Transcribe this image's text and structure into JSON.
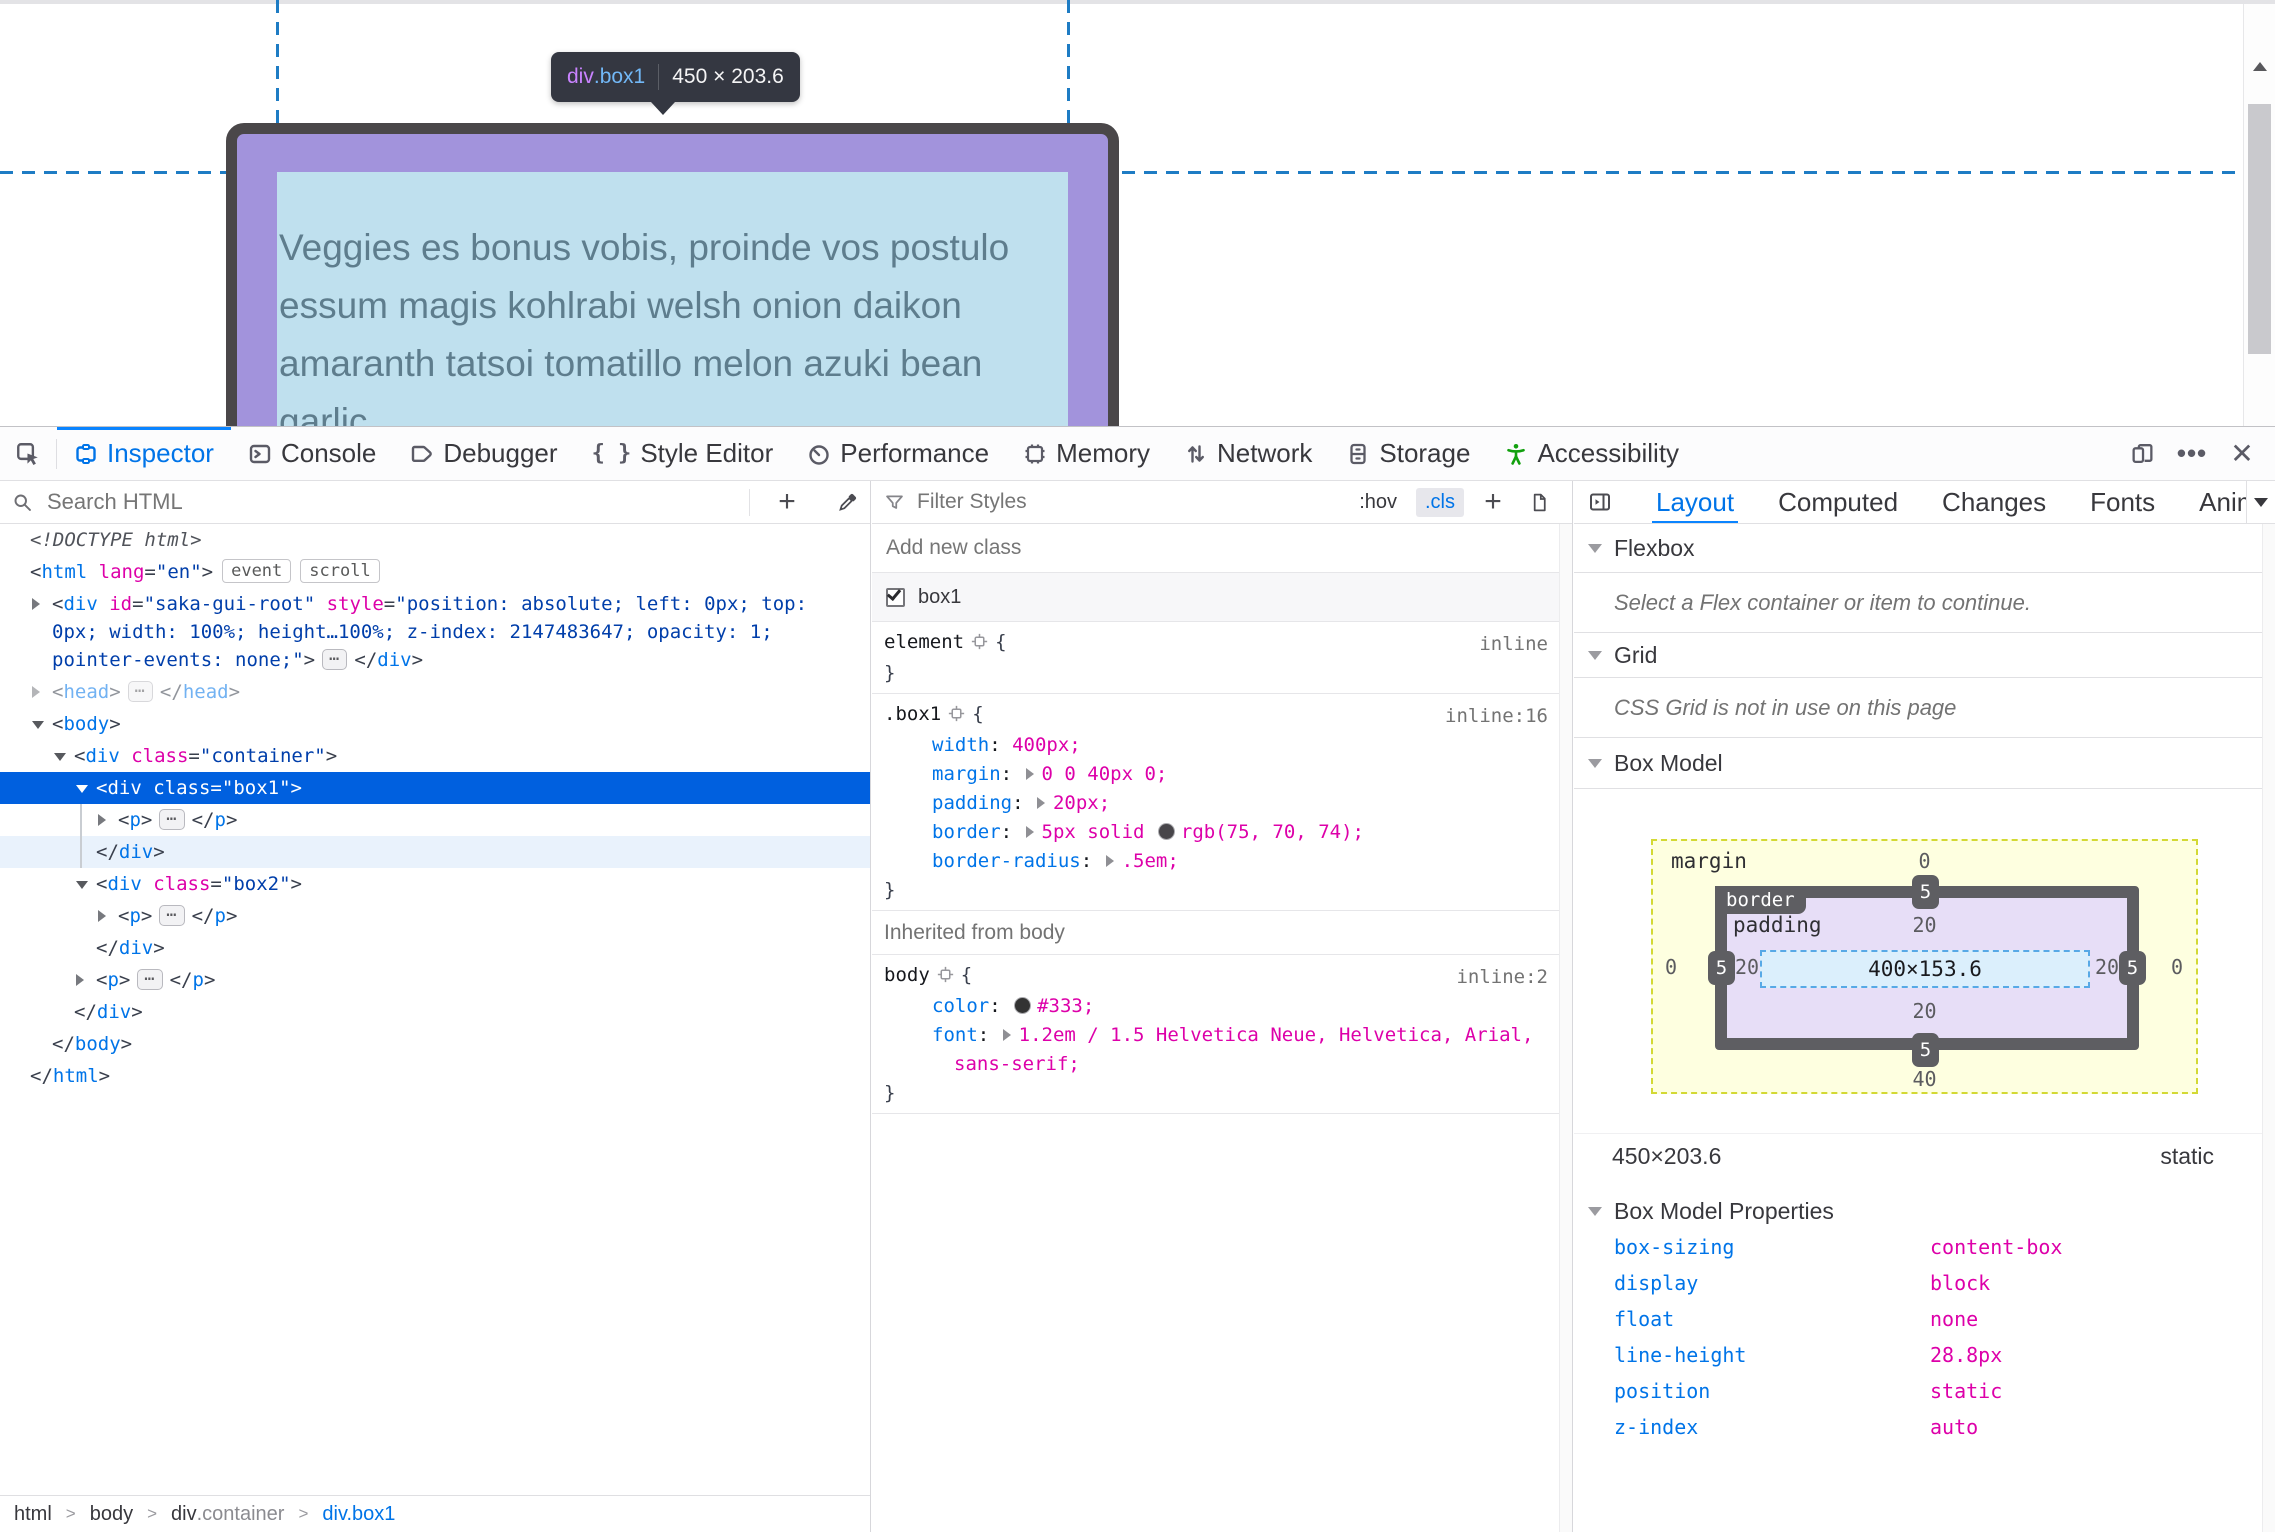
{
  "page": {
    "tooltip": {
      "tag": "div",
      "cls": ".box1",
      "dims": "450 × 203.6"
    },
    "text_lines": [
      "Veggies es bonus vobis, proinde vos postulo",
      "essum magis kohlrabi welsh onion daikon",
      "amaranth tatsoi tomatillo melon azuki bean",
      "garlic"
    ]
  },
  "toolbar": {
    "tabs": [
      {
        "id": "inspector",
        "label": "Inspector"
      },
      {
        "id": "console",
        "label": "Console"
      },
      {
        "id": "debugger",
        "label": "Debugger"
      },
      {
        "id": "style-editor",
        "label": "Style Editor"
      },
      {
        "id": "performance",
        "label": "Performance"
      },
      {
        "id": "memory",
        "label": "Memory"
      },
      {
        "id": "network",
        "label": "Network"
      },
      {
        "id": "storage",
        "label": "Storage"
      },
      {
        "id": "accessibility",
        "label": "Accessibility"
      }
    ]
  },
  "markup_panel": {
    "search_placeholder": "Search HTML",
    "tree": [
      {
        "indent": 0,
        "segs": [
          {
            "t": "doctype",
            "s": "<!DOCTYPE html>"
          }
        ]
      },
      {
        "indent": 0,
        "segs": [
          {
            "t": "p",
            "s": "<"
          },
          {
            "t": "tag",
            "s": "html"
          },
          {
            "t": "attr",
            "s": " lang"
          },
          {
            "t": "p",
            "s": "="
          },
          {
            "t": "val",
            "s": "\"en\""
          },
          {
            "t": "p",
            "s": ">"
          },
          {
            "t": "badge",
            "s": "event"
          },
          {
            "t": "badge",
            "s": "scroll"
          }
        ]
      },
      {
        "indent": 1,
        "arrow": "closed",
        "segs": [
          {
            "t": "p",
            "s": "<"
          },
          {
            "t": "tag",
            "s": "div"
          },
          {
            "t": "attr",
            "s": " id"
          },
          {
            "t": "p",
            "s": "="
          },
          {
            "t": "val",
            "s": "\"saka-gui-root\""
          },
          {
            "t": "attr",
            "s": " style"
          },
          {
            "t": "p",
            "s": "="
          },
          {
            "t": "val",
            "s": "\"position: absolute; left: 0px; top:"
          }
        ]
      },
      {
        "indent": 1,
        "cont": true,
        "segs": [
          {
            "t": "val",
            "s": "0px; width: 100%; height…100%; z-index: 2147483647; opacity: 1;"
          }
        ]
      },
      {
        "indent": 1,
        "cont": true,
        "segs": [
          {
            "t": "val",
            "s": "pointer-events: none;\""
          },
          {
            "t": "p",
            "s": ">"
          },
          {
            "t": "dots",
            "s": "⋯"
          },
          {
            "t": "p",
            "s": "</"
          },
          {
            "t": "tag",
            "s": "div"
          },
          {
            "t": "p",
            "s": ">"
          }
        ]
      },
      {
        "indent": 1,
        "arrow": "closed",
        "dim": true,
        "segs": [
          {
            "t": "p",
            "s": "<"
          },
          {
            "t": "tag",
            "s": "head"
          },
          {
            "t": "p",
            "s": ">"
          },
          {
            "t": "dots",
            "s": "⋯"
          },
          {
            "t": "p",
            "s": "</"
          },
          {
            "t": "tag",
            "s": "head"
          },
          {
            "t": "p",
            "s": ">"
          }
        ]
      },
      {
        "indent": 1,
        "arrow": "open",
        "segs": [
          {
            "t": "p",
            "s": "<"
          },
          {
            "t": "tag",
            "s": "body"
          },
          {
            "t": "p",
            "s": ">"
          }
        ]
      },
      {
        "indent": 2,
        "arrow": "open",
        "segs": [
          {
            "t": "p",
            "s": "<"
          },
          {
            "t": "tag",
            "s": "div"
          },
          {
            "t": "attr",
            "s": " class"
          },
          {
            "t": "p",
            "s": "="
          },
          {
            "t": "val",
            "s": "\"container\""
          },
          {
            "t": "p",
            "s": ">"
          }
        ]
      },
      {
        "indent": 3,
        "arrow": "open",
        "selected": true,
        "segs": [
          {
            "t": "p",
            "s": "<"
          },
          {
            "t": "tag",
            "s": "div"
          },
          {
            "t": "attr",
            "s": " class"
          },
          {
            "t": "p",
            "s": "="
          },
          {
            "t": "val",
            "s": "\"box1\""
          },
          {
            "t": "p",
            "s": ">"
          }
        ]
      },
      {
        "indent": 4,
        "arrow": "closed",
        "segs": [
          {
            "t": "p",
            "s": "<"
          },
          {
            "t": "tag",
            "s": "p"
          },
          {
            "t": "p",
            "s": ">"
          },
          {
            "t": "dots",
            "s": "⋯"
          },
          {
            "t": "p",
            "s": "</"
          },
          {
            "t": "tag",
            "s": "p"
          },
          {
            "t": "p",
            "s": ">"
          }
        ]
      },
      {
        "indent": 3,
        "hl": true,
        "segs": [
          {
            "t": "p",
            "s": "</"
          },
          {
            "t": "tag",
            "s": "div"
          },
          {
            "t": "p",
            "s": ">"
          }
        ]
      },
      {
        "indent": 3,
        "arrow": "open",
        "segs": [
          {
            "t": "p",
            "s": "<"
          },
          {
            "t": "tag",
            "s": "div"
          },
          {
            "t": "attr",
            "s": " class"
          },
          {
            "t": "p",
            "s": "="
          },
          {
            "t": "val",
            "s": "\"box2\""
          },
          {
            "t": "p",
            "s": ">"
          }
        ]
      },
      {
        "indent": 4,
        "arrow": "closed",
        "segs": [
          {
            "t": "p",
            "s": "<"
          },
          {
            "t": "tag",
            "s": "p"
          },
          {
            "t": "p",
            "s": ">"
          },
          {
            "t": "dots",
            "s": "⋯"
          },
          {
            "t": "p",
            "s": "</"
          },
          {
            "t": "tag",
            "s": "p"
          },
          {
            "t": "p",
            "s": ">"
          }
        ]
      },
      {
        "indent": 3,
        "segs": [
          {
            "t": "p",
            "s": "</"
          },
          {
            "t": "tag",
            "s": "div"
          },
          {
            "t": "p",
            "s": ">"
          }
        ]
      },
      {
        "indent": 3,
        "arrow": "closed",
        "segs": [
          {
            "t": "p",
            "s": "<"
          },
          {
            "t": "tag",
            "s": "p"
          },
          {
            "t": "p",
            "s": ">"
          },
          {
            "t": "dots",
            "s": "⋯"
          },
          {
            "t": "p",
            "s": "</"
          },
          {
            "t": "tag",
            "s": "p"
          },
          {
            "t": "p",
            "s": ">"
          }
        ]
      },
      {
        "indent": 2,
        "segs": [
          {
            "t": "p",
            "s": "</"
          },
          {
            "t": "tag",
            "s": "div"
          },
          {
            "t": "p",
            "s": ">"
          }
        ]
      },
      {
        "indent": 1,
        "segs": [
          {
            "t": "p",
            "s": "</"
          },
          {
            "t": "tag",
            "s": "body"
          },
          {
            "t": "p",
            "s": ">"
          }
        ]
      },
      {
        "indent": 0,
        "segs": [
          {
            "t": "p",
            "s": "</"
          },
          {
            "t": "tag",
            "s": "html"
          },
          {
            "t": "p",
            "s": ">"
          }
        ]
      }
    ],
    "breadcrumb": [
      {
        "label": "html"
      },
      {
        "label": "body"
      },
      {
        "label": "div",
        "muted": ".container"
      },
      {
        "label": "div.box1",
        "selected": true
      }
    ]
  },
  "rules_panel": {
    "filter_placeholder": "Filter Styles",
    "pseudo_label": ":hov",
    "class_label": ".cls",
    "add_class_placeholder": "Add new class",
    "class_toggle": {
      "name": "box1",
      "checked": true
    },
    "rules": [
      {
        "selector": "element",
        "location": "inline",
        "props": []
      },
      {
        "selector": ".box1",
        "location": "inline:16",
        "props": [
          {
            "name": "width",
            "value": "400px;"
          },
          {
            "name": "margin",
            "arrow": true,
            "value": "0 0 40px 0;"
          },
          {
            "name": "padding",
            "arrow": true,
            "value": "20px;"
          },
          {
            "name": "border",
            "arrow": true,
            "value_pre": "5px solid ",
            "swatch": "#48464a",
            "value": "rgb(75, 70, 74);"
          },
          {
            "name": "border-radius",
            "arrow": true,
            "value": ".5em;"
          }
        ]
      }
    ],
    "inherited_header": "Inherited from body",
    "inherited_rules": [
      {
        "selector": "body",
        "location": "inline:2",
        "props": [
          {
            "name": "color",
            "swatch": "#333",
            "value": "#333;"
          },
          {
            "name": "font",
            "arrow": true,
            "value": "1.2em / 1.5 Helvetica Neue, Helvetica, Arial,",
            "wrap": "sans-serif;"
          }
        ]
      }
    ]
  },
  "layout_panel": {
    "tabs": [
      "Layout",
      "Computed",
      "Changes",
      "Fonts",
      "Animations"
    ],
    "flexbox": {
      "title": "Flexbox",
      "message": "Select a Flex container or item to continue."
    },
    "grid": {
      "title": "Grid",
      "message": "CSS Grid is not in use on this page"
    },
    "box_model": {
      "title": "Box Model",
      "labels": {
        "margin": "margin",
        "border": "border",
        "padding": "padding"
      },
      "margin": {
        "top": "0",
        "right": "0",
        "bottom": "40",
        "left": "0"
      },
      "border": {
        "top": "5",
        "right": "5",
        "bottom": "5",
        "left": "5"
      },
      "padding": {
        "top": "20",
        "right": "20",
        "bottom": "20",
        "left": "20"
      },
      "content": "400×153.6",
      "dimensions": "450×203.6",
      "position": "static",
      "properties_title": "Box Model Properties",
      "properties": [
        {
          "name": "box-sizing",
          "value": "content-box"
        },
        {
          "name": "display",
          "value": "block"
        },
        {
          "name": "float",
          "value": "none"
        },
        {
          "name": "line-height",
          "value": "28.8px"
        },
        {
          "name": "position",
          "value": "static"
        },
        {
          "name": "z-index",
          "value": "auto"
        }
      ]
    }
  }
}
